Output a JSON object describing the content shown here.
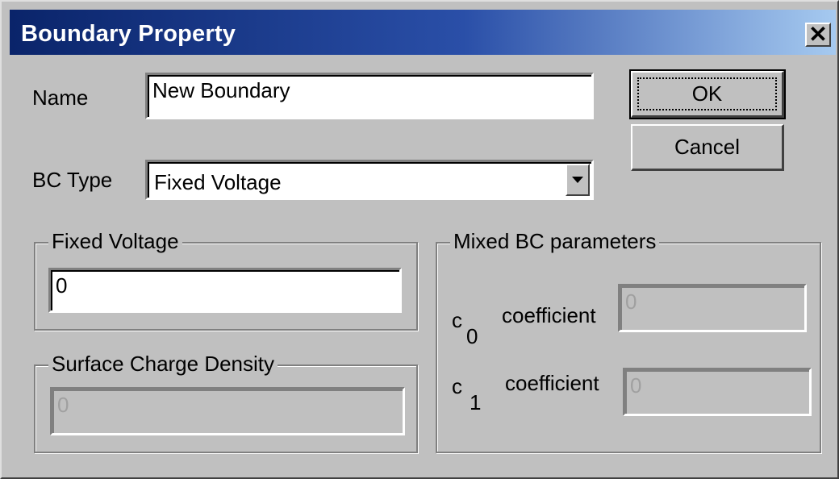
{
  "window": {
    "title": "Boundary Property",
    "close_glyph": "✕"
  },
  "name": {
    "label": "Name",
    "value": "New Boundary"
  },
  "bc_type": {
    "label": "BC Type",
    "selected": "Fixed Voltage"
  },
  "buttons": {
    "ok": "OK",
    "cancel": "Cancel"
  },
  "fixed_voltage": {
    "group_label": "Fixed Voltage",
    "value": "0"
  },
  "surface_charge": {
    "group_label": "Surface Charge Density",
    "value": "0"
  },
  "mixed": {
    "group_label": "Mixed BC parameters",
    "c0": {
      "base": "c",
      "subscript": "0",
      "suffix": "coefficient",
      "value": "0"
    },
    "c1": {
      "base": "c",
      "subscript": "1",
      "suffix": "coefficient",
      "value": "0"
    }
  }
}
